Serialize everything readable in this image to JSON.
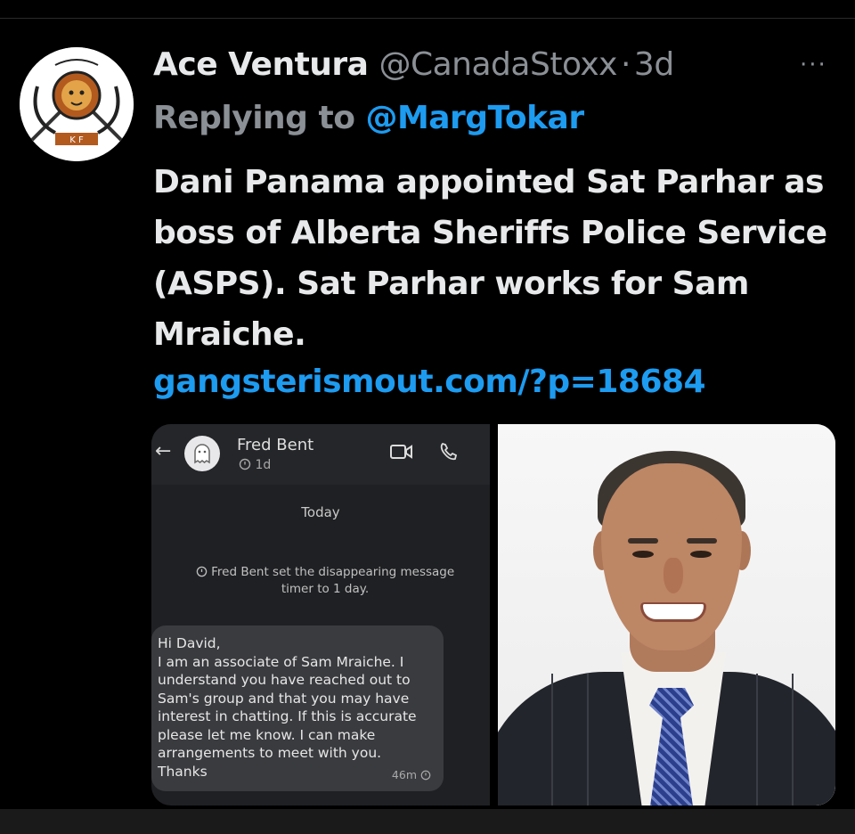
{
  "tweet": {
    "display_name": "Ace Ventura",
    "handle": "@CanadaStoxx",
    "separator": "·",
    "age": "3d",
    "more_label": "···",
    "replying_prefix": "Replying to",
    "replying_to": "@MargTokar",
    "text": "Dani Panama appointed Sat Parhar as boss of Alberta Sheriffs Police Service (ASPS). Sat Parhar works for Sam Mraiche.",
    "link": "gangsterismout.com/?p=18684"
  },
  "avatar": {
    "icon": "lion-emblem-logo-icon"
  },
  "media": {
    "chat_screenshot": {
      "back_icon": "←",
      "contact_name": "Fred Bent",
      "contact_timer": "1d",
      "day_label": "Today",
      "system_message": "Fred Bent set the disappearing message timer to 1 day.",
      "message": "Hi David,\nI am an associate of Sam Mraiche. I\nunderstand you have reached out to\nSam's group and that you may have\ninterest in chatting. If this is accurate\nplease let me know. I can make\narrangements to meet with you.\nThanks",
      "message_time": "46m",
      "icons": [
        "back-arrow-icon",
        "ghost-avatar-icon",
        "timer-icon",
        "video-call-icon",
        "phone-call-icon"
      ]
    },
    "photo": {
      "subject": "portrait-photo"
    }
  },
  "colors": {
    "background": "#000000",
    "text": "#e7e9ea",
    "muted": "#8b9096",
    "link": "#1d9bf0"
  }
}
